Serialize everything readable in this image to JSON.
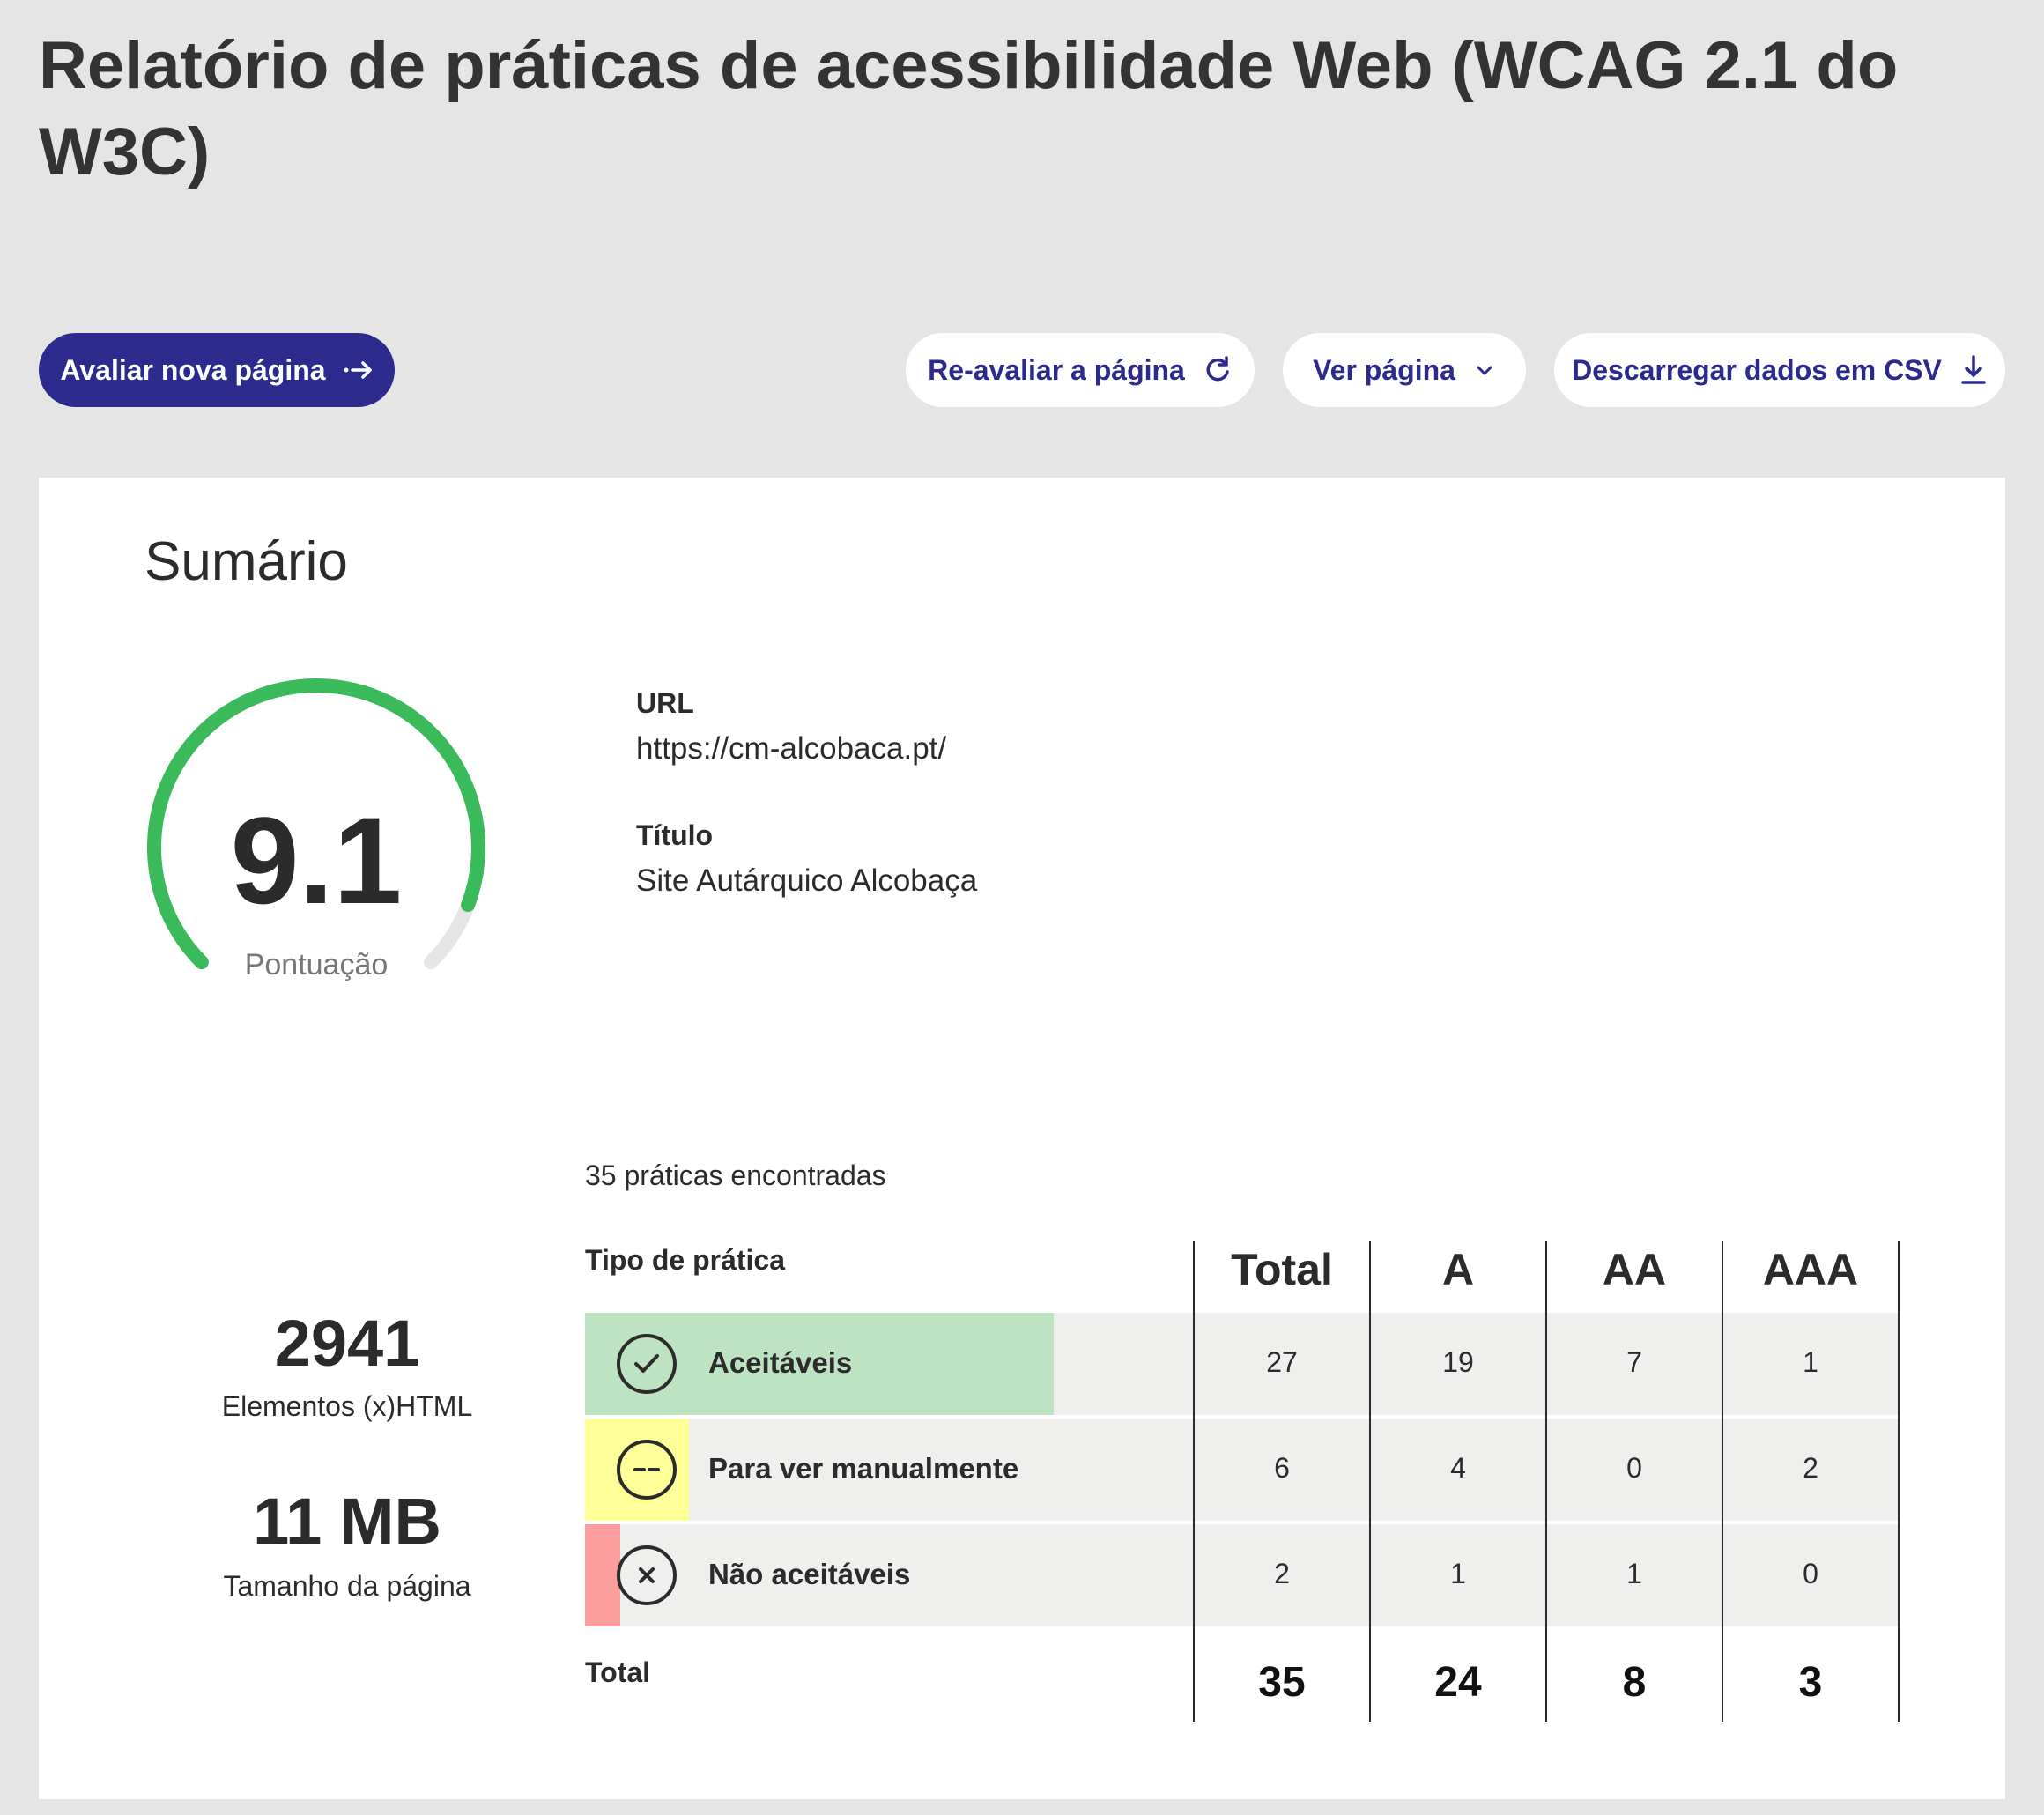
{
  "header": {
    "title": "Relatório de práticas de acessibilidade Web (WCAG 2.1 do W3C)"
  },
  "toolbar": {
    "evaluate_new_label": "Avaliar nova página",
    "reevaluate_label": "Re-avaliar a página",
    "view_page_label": "Ver página",
    "download_csv_label": "Descarregar dados em CSV"
  },
  "summary": {
    "title": "Sumário",
    "score": {
      "value": "9.1",
      "label": "Pontuação",
      "max": 10
    },
    "url_label": "URL",
    "url_value": "https://cm-alcobaca.pt/",
    "title_label": "Título",
    "title_value": "Site Autárquico Alcobaça",
    "elements_value": "2941",
    "elements_label": "Elementos (x)HTML",
    "size_value": "11 MB",
    "size_label": "Tamanho da página",
    "practices_count": "35 práticas encontradas",
    "table": {
      "type_header": "Tipo de prática",
      "columns": [
        "Total",
        "A",
        "AA",
        "AAA"
      ],
      "rows": [
        {
          "label": "Aceitáveis",
          "values": [
            "27",
            "19",
            "7",
            "1"
          ],
          "color": "#bee3c2",
          "icon": "check-icon"
        },
        {
          "label": "Para ver manualmente",
          "values": [
            "6",
            "4",
            "0",
            "2"
          ],
          "color": "#ffff99",
          "icon": "dash-icon"
        },
        {
          "label": "Não aceitáveis",
          "values": [
            "2",
            "1",
            "1",
            "0"
          ],
          "color": "#fd9e9e",
          "icon": "x-icon"
        }
      ],
      "total_label": "Total",
      "totals": [
        "35",
        "24",
        "8",
        "3"
      ]
    }
  },
  "colors": {
    "primary": "#2c2a8c",
    "gauge_green": "#3aba5a",
    "gauge_track": "#e5e5e5"
  }
}
